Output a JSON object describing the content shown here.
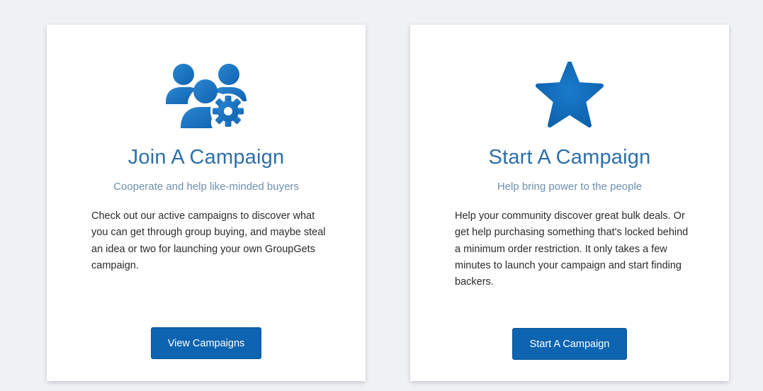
{
  "cards": [
    {
      "icon": "group-gear-icon",
      "title": "Join A Campaign",
      "subtitle": "Cooperate and help like-minded buyers",
      "description": "Check out our active campaigns to discover what you can get through group buying, and maybe steal an idea or two for launching your own GroupGets campaign.",
      "button_label": "View Campaigns"
    },
    {
      "icon": "star-icon",
      "title": "Start A Campaign",
      "subtitle": "Help bring power to the people",
      "description": "Help your community discover great bulk deals. Or get help purchasing something that's locked behind a minimum order restriction. It only takes a few minutes to launch your campaign and start finding backers.",
      "button_label": "Start A Campaign"
    }
  ],
  "colors": {
    "accent": "#0d64b0",
    "icon_blue": "#1b75c2",
    "title": "#2d6fa8",
    "subtitle": "#6f8fae",
    "background": "#f0f1f5"
  }
}
